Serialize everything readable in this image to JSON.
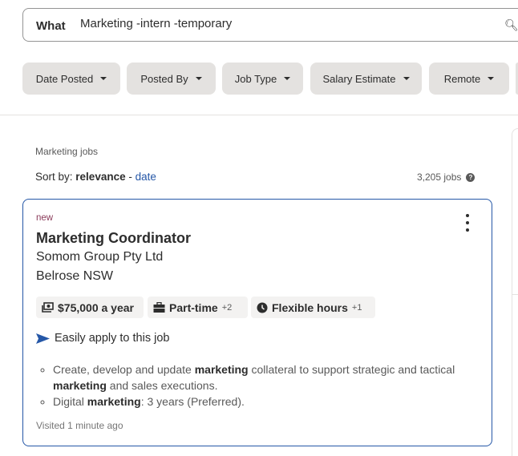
{
  "search": {
    "label": "What",
    "value": "Marketing -intern -temporary",
    "icon": "search-icon"
  },
  "filters": [
    {
      "label": "Date Posted"
    },
    {
      "label": "Posted By"
    },
    {
      "label": "Job Type"
    },
    {
      "label": "Salary Estimate"
    },
    {
      "label": "Remote"
    }
  ],
  "results": {
    "heading": "Marketing jobs",
    "sort_prefix": "Sort by:",
    "sort_active": "relevance",
    "sort_sep": " - ",
    "sort_other": "date",
    "count": "3,205 jobs"
  },
  "job": {
    "badge": "new",
    "title": "Marketing Coordinator",
    "company": "Somom Group Pty Ltd",
    "location": "Belrose NSW",
    "tags": [
      {
        "icon": "money-icon",
        "label": "$75,000 a year",
        "more": ""
      },
      {
        "icon": "briefcase-icon",
        "label": "Part-time",
        "more": "+2"
      },
      {
        "icon": "clock-icon",
        "label": "Flexible hours",
        "more": "+1"
      }
    ],
    "apply": "Easily apply to this job",
    "snippet": [
      {
        "a": "Create, develop and update ",
        "b": "marketing",
        "c": " collateral to support strategic and tactical ",
        "d": "marketing",
        "e": " and sales executions."
      },
      {
        "a": "Digital ",
        "b": "marketing",
        "c": ": 3 years (Preferred)."
      }
    ],
    "visited": "Visited 1 minute ago"
  },
  "colors": {
    "accent": "#2557a7",
    "pill": "#e4e2e0",
    "badge": "#8a3b5a"
  }
}
